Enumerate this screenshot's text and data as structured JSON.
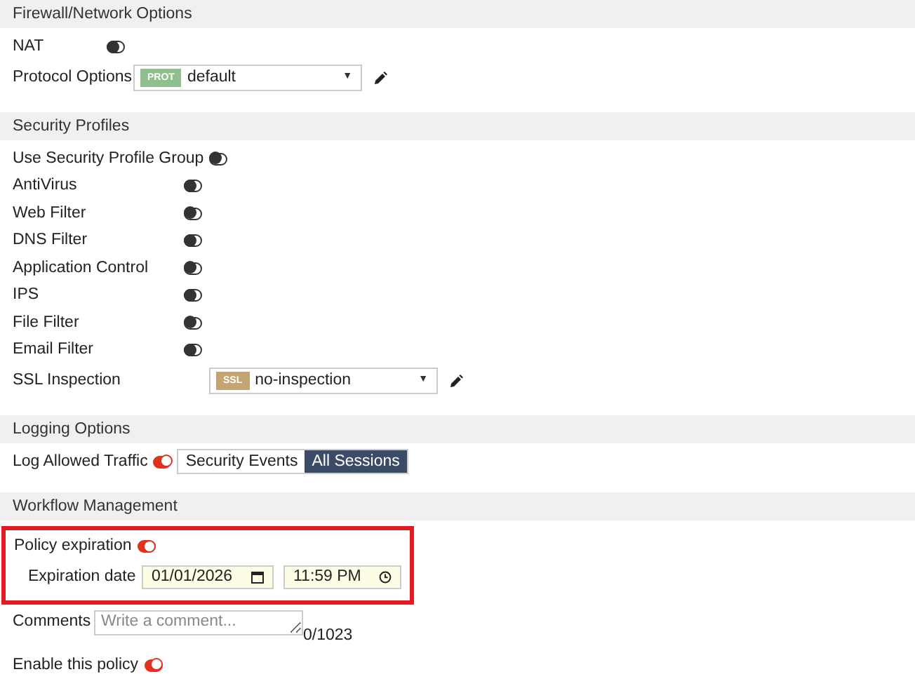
{
  "sections": [
    {
      "title": "Firewall/Network Options",
      "rows": [
        {
          "kind": "toggle",
          "label": "NAT",
          "on": false
        },
        {
          "kind": "select",
          "label": "Protocol Options",
          "tag": "PROT",
          "color": "#8fbf8f",
          "value": "default",
          "caret": "▼"
        }
      ]
    },
    {
      "title": "Security Profiles",
      "rows": [
        {
          "kind": "toggle",
          "label": "Use Security Profile Group",
          "on": false
        },
        {
          "kind": "toggle",
          "label": "AntiVirus",
          "on": false
        },
        {
          "kind": "toggle",
          "label": "Web Filter",
          "on": false
        },
        {
          "kind": "toggle",
          "label": "DNS Filter",
          "on": false
        },
        {
          "kind": "toggle",
          "label": "Application Control",
          "on": false
        },
        {
          "kind": "toggle",
          "label": "IPS",
          "on": false
        },
        {
          "kind": "toggle",
          "label": "File Filter",
          "on": false
        },
        {
          "kind": "toggle",
          "label": "Email Filter",
          "on": false
        },
        {
          "kind": "select",
          "label": "SSL Inspection",
          "tag": "SSL",
          "color": "#c4a472",
          "value": "no-inspection",
          "caret": "▼"
        }
      ]
    },
    {
      "title": "Logging Options",
      "rows": [
        {
          "kind": "toggle_segmented",
          "label": "Log Allowed Traffic",
          "on": true,
          "options": [
            {
              "label": "Security Events",
              "selected": false
            },
            {
              "label": "All Sessions",
              "selected": true
            }
          ]
        }
      ]
    },
    {
      "title": "Workflow Management",
      "rows": [
        {
          "kind": "group",
          "outlined": true,
          "rows": [
            {
              "kind": "toggle",
              "label": "Policy expiration",
              "on": true
            },
            {
              "kind": "datetime",
              "label": "Expiration date",
              "date": "01/01/2026",
              "time": "11:59 PM"
            }
          ]
        },
        {
          "kind": "textarea",
          "label": "Comments",
          "placeholder": "Write a comment...",
          "counter": "0/1023"
        },
        {
          "kind": "toggle",
          "label": "Enable this policy",
          "on": true
        }
      ]
    }
  ]
}
